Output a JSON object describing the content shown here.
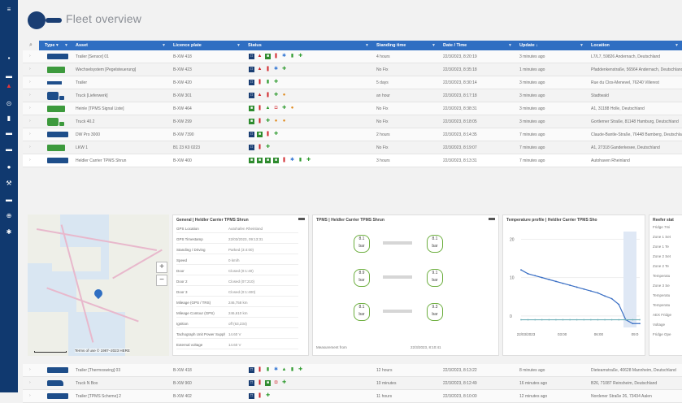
{
  "header": {
    "title": "Fleet overview"
  },
  "sidebar": {
    "icons": [
      "menu-icon",
      "grid-icon",
      "list-icon",
      "alert-icon",
      "clock-icon",
      "truck-icon",
      "chart-icon",
      "trailer-icon",
      "settings-icon",
      "wrench-icon",
      "report-icon",
      "globe-icon",
      "gear-icon"
    ]
  },
  "columns": [
    {
      "label": "Type ▾",
      "x": 24,
      "w": 36
    },
    {
      "label": "Asset",
      "x": 62,
      "w": 118
    },
    {
      "label": "Licence plate",
      "x": 182,
      "w": 90
    },
    {
      "label": "Status",
      "x": 274,
      "w": 156
    },
    {
      "label": "Standing time",
      "x": 432,
      "w": 80
    },
    {
      "label": "Date / Time",
      "x": 514,
      "w": 92
    },
    {
      "label": "Update ↓",
      "x": 608,
      "w": 86
    },
    {
      "label": "Location",
      "x": 696,
      "w": 115
    }
  ],
  "rows": [
    {
      "vehicle": "trailer",
      "asset": "Trailer [Sensor] 01",
      "plate": "B-XW 418",
      "status": [
        "box",
        "warn",
        "gbox",
        "thermo",
        "snow",
        "green",
        "cross"
      ],
      "standing": "4 hours",
      "datetime": "22/3/2023, 8:20:19",
      "update": "3 minutes ago",
      "location": "L7/L7, 59826 Andernach, Deutschland"
    },
    {
      "vehicle": "truck",
      "asset": "Wechselsystem [Pegelsteuerung]",
      "plate": "B-XW 423",
      "status": [
        "box",
        "warn",
        "thermo",
        "snow",
        "cross"
      ],
      "standing": "No Fix",
      "datetime": "22/3/2023, 8:35:18",
      "update": "1 minutes ago",
      "location": "Pfaddenkenstraße, 56564 Andernach, Deutschland"
    },
    {
      "vehicle": "plane",
      "asset": "Trailer",
      "plate": "B-XW 420",
      "status": [
        "box",
        "thermo",
        "green",
        "cross"
      ],
      "standing": "5 days",
      "datetime": "22/3/2023, 8:30:14",
      "update": "3 minutes ago",
      "location": "Rue du Clos-Menevel, 76240 Villerest"
    },
    {
      "vehicle": "tractor",
      "asset": "Truck [Lieferwerk]",
      "plate": "B-XW 301",
      "status": [
        "box",
        "warn",
        "thermo",
        "cross",
        "person"
      ],
      "standing": "an hour",
      "datetime": "22/3/2023, 8:17:18",
      "update": "3 minutes ago",
      "location": "Stadtwald"
    },
    {
      "vehicle": "truck",
      "asset": "Heinle [TPMS Signal Liste]",
      "plate": "B-XW 464",
      "status": [
        "gbox",
        "thermo",
        "lock",
        "car",
        "cross",
        "person"
      ],
      "standing": "No Fix",
      "datetime": "22/3/2023, 8:38:31",
      "update": "3 minutes ago",
      "location": "A1, 31188 Holle, Deutschland"
    },
    {
      "vehicle": "tractor-green",
      "asset": "Truck 40.2",
      "plate": "B-XW 299",
      "status": [
        "gbox",
        "thermo",
        "cross",
        "person",
        "person"
      ],
      "standing": "No Fix",
      "datetime": "22/3/2023, 8:18:05",
      "update": "3 minutes ago",
      "location": "Gortlerner Straße, 81148 Hamburg, Deutschland"
    },
    {
      "vehicle": "trailer",
      "asset": "DW Pro 3000",
      "plate": "B-XW 7390",
      "status": [
        "box",
        "gbox",
        "thermo",
        "cross"
      ],
      "standing": "2 hours",
      "datetime": "22/3/2023, 8:14:35",
      "update": "7 minutes ago",
      "location": "Claude-Bantle-Straße, 76448 Bamberg, Deutschland"
    },
    {
      "vehicle": "truck",
      "asset": "LKW 1",
      "plate": "B1 23 K0 0223",
      "status": [
        "box",
        "thermo",
        "cross"
      ],
      "standing": "No Fix",
      "datetime": "22/3/2023, 8:19:07",
      "update": "7 minutes ago",
      "location": "A1, 27318 Ganderkesee, Deutschland"
    },
    {
      "vehicle": "trailer",
      "asset": "Heldler Carrier TPMS Shrun",
      "plate": "B-XW 400",
      "status": [
        "gbox",
        "gbox",
        "gbox",
        "gbox",
        "thermo",
        "snow",
        "green",
        "cross"
      ],
      "standing": "3 hours",
      "datetime": "22/3/2023, 8:13:31",
      "update": "7 minutes ago",
      "location": "Autohaven Rheinland"
    }
  ],
  "rows_after": [
    {
      "vehicle": "trailer",
      "asset": "Trailer [Thermoswing] 03",
      "plate": "B-XW 418",
      "status": [
        "box",
        "thermo",
        "green",
        "snow",
        "lock",
        "green",
        "cross"
      ],
      "standing": "12 hours",
      "datetime": "22/3/2023, 8:13:22",
      "update": "8 minutes ago",
      "location": "Dieteamstraße, 40628 Mannheim, Deutschland"
    },
    {
      "vehicle": "van",
      "asset": "Truck N Box",
      "plate": "B-XW 960",
      "status": [
        "box",
        "thermo",
        "gbox",
        "car",
        "cross"
      ],
      "standing": "10 minutes",
      "datetime": "22/3/2023, 8:12:49",
      "update": "16 minutes ago",
      "location": "B26, 71087 Reinsheim, Deutschland"
    },
    {
      "vehicle": "trailer",
      "asset": "Trailer [TPMS Scheme] 2",
      "plate": "B-XW 402",
      "status": [
        "box",
        "thermo",
        "cross"
      ],
      "standing": "11 hours",
      "datetime": "22/3/2023, 8:10:00",
      "update": "12 minutes ago",
      "location": "Nordener Straße 26, 73434 Aalen"
    }
  ],
  "map": {
    "attribution": "Terms of use",
    "copyright": "© 1987–2023 HERE",
    "zoom_in": "+",
    "zoom_out": "−"
  },
  "general": {
    "title": "General | Heldler Carrier TPMS Shrun",
    "fields": [
      {
        "k": "GPS Location",
        "v": "Autohafen Rheinland"
      },
      {
        "k": "GPS Timestamp",
        "v": "22/03/2023, 09:13:31"
      },
      {
        "k": "Standing / Driving",
        "v": "Parked (3:4:00)"
      },
      {
        "k": "Speed",
        "v": "0 km/h"
      },
      {
        "k": "Door",
        "v": "Closed (0:1:40)"
      },
      {
        "k": "Door 2",
        "v": "Closed (07:210)"
      },
      {
        "k": "Door 3",
        "v": "Closed (0:1:400)"
      },
      {
        "k": "Mileage (GPS / TRS)",
        "v": "246,758 km"
      },
      {
        "k": "Mileage Contour (GPS)",
        "v": "246,610 km"
      },
      {
        "k": "Ignition",
        "v": "off (63,234)"
      },
      {
        "k": "Tachograph Unit Power Supply",
        "v": "14.60 V"
      },
      {
        "k": "External voltage",
        "v": "14.60 V"
      }
    ]
  },
  "tpms": {
    "title": "TPMS | Heldler Carrier TPMS Shrun",
    "tyres": [
      {
        "val": "8.1",
        "unit": "bar"
      },
      {
        "val": "8.1",
        "unit": "bar"
      },
      {
        "val": "8.9",
        "unit": "bar"
      },
      {
        "val": "9.1",
        "unit": "bar"
      },
      {
        "val": "8.1",
        "unit": "bar"
      },
      {
        "val": "9.3",
        "unit": "bar"
      }
    ],
    "footer_label": "Measurement from",
    "footer_value": "22/3/2023, 8:10:41"
  },
  "temperature": {
    "title": "Temperature profile | Heldler Carrier TPMS Sho",
    "x_ticks": [
      "22/03/2023",
      "03:00",
      "06:00",
      "09:0"
    ]
  },
  "reefer": {
    "title": "Reefer stat",
    "lines": [
      "Fridge 7mi",
      "Zone 1 Set",
      "Zone 1 Te",
      "Zone 2 Set",
      "Zone 2 Te",
      "Temperatu",
      "Zone 3 Se",
      "Temperatu",
      "Temperatu",
      "AEX Fridge",
      "Voltage",
      "Fridge Ope"
    ]
  },
  "chart_data": {
    "type": "line",
    "title": "Temperature profile | Heldler Carrier TPMS Sho",
    "x": [
      "22/03/2023",
      "03:00",
      "06:00",
      "09:0"
    ],
    "y_ticks": [
      20,
      10,
      0
    ],
    "series": [
      {
        "values": [
          12,
          11,
          10.5,
          10,
          9.5,
          9,
          8.5,
          8,
          7.5,
          7,
          6.5,
          6,
          5.2,
          4.5,
          3,
          -1,
          -2,
          -2
        ]
      },
      {
        "values": [
          -1,
          -1,
          -1,
          -1,
          -1,
          -1,
          -1,
          -1,
          -1,
          -1,
          -1,
          -1,
          -1,
          -1,
          -1,
          -1,
          -1,
          -1
        ]
      }
    ],
    "ylim": [
      -3,
      22
    ]
  }
}
